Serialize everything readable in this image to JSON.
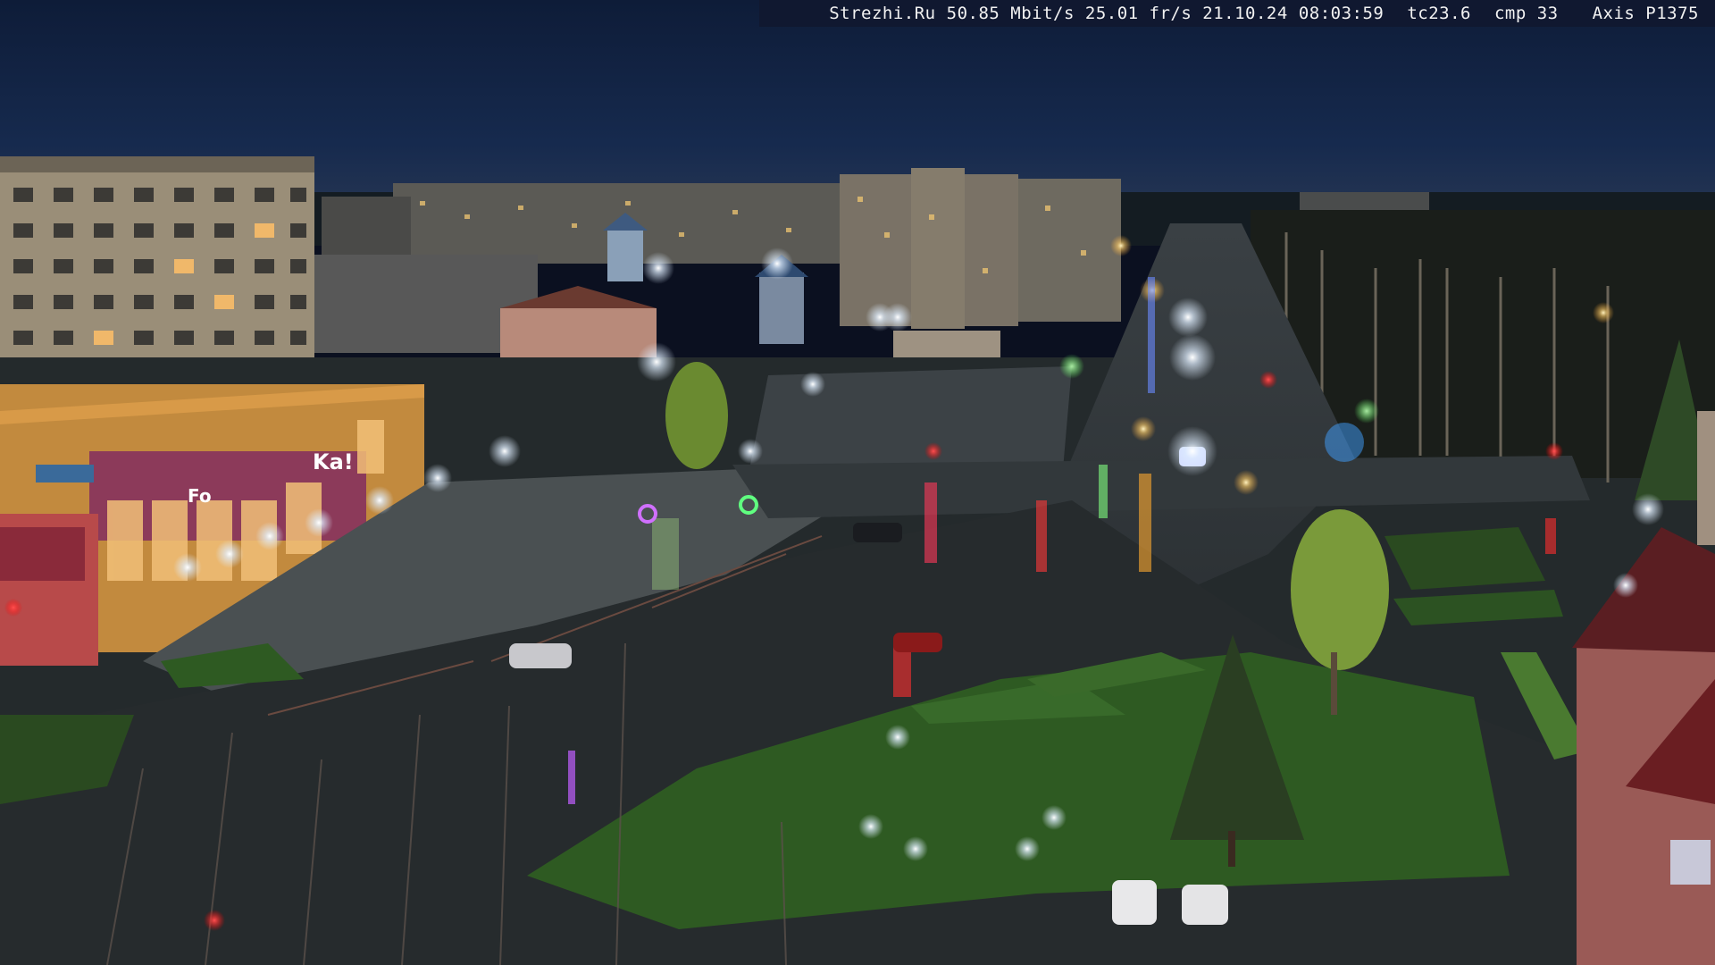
{
  "overlay": {
    "site": "Strezhi.Ru",
    "bandwidth": "50.85 Mbit/s",
    "framerate": "25.01 fr/s",
    "date": "21.10.24",
    "time": "08:03:59",
    "tc": "tc23.6",
    "cmp": "cmp 33",
    "camera": "Axis P1375"
  },
  "storefront": {
    "sign_left": "Ka!",
    "sign_right": "Fo"
  },
  "colors": {
    "sky": "#142646",
    "road": "#2c3236",
    "grass": "#2e5a22",
    "building": "#9a8e78",
    "store": "#c28a3e",
    "light": "#eaf4ff"
  }
}
